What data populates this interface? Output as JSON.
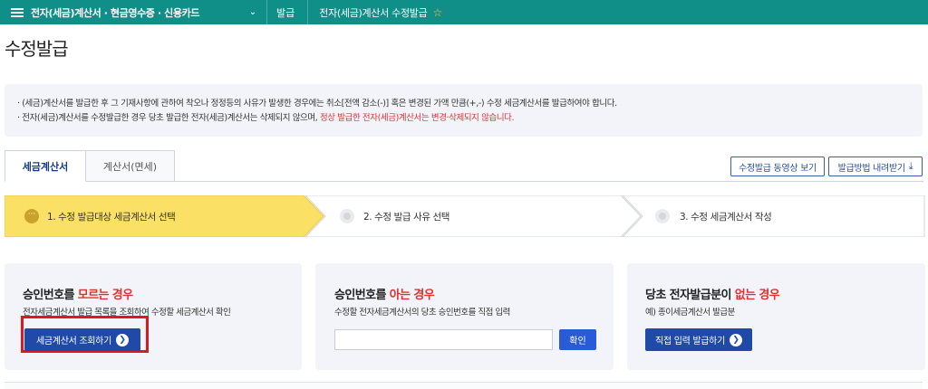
{
  "topbar": {
    "section": "전자(세금)계산서 · 현금영수증 · 신용카드",
    "crumb_issue": "발급",
    "crumb_page": "전자(세금)계산서 수정발급",
    "star": "☆"
  },
  "page_title": "수정발급",
  "notice": {
    "line1": "(세금)계산서를 발급한 후 그 기재사항에 관하여 착오나 정정등의 사유가 발생한 경우에는 취소[전액 감소(-)] 혹은 변경된 가액 만큼(+,-) 수정 세금계산서를 발급하여야 합니다.",
    "line2_main": "전자(세금)계산서를 수정발급한 경우 당초 발급한 전자(세금)계산서는 삭제되지 않으며,",
    "line2_red": "정상 발급한 전자(세금)계산서는 변경·삭제되지 않습니다."
  },
  "tabs": [
    {
      "label": "세금계산서",
      "active": true
    },
    {
      "label": "계산서(면세)",
      "active": false
    }
  ],
  "buttons": {
    "video": "수정발급 동영상 보기",
    "download": "발급방법 내려받기"
  },
  "steps": [
    {
      "label": "1. 수정 발급대상 세금계산서 선택",
      "active": true
    },
    {
      "label": "2. 수정 발급 사유 선택",
      "active": false
    },
    {
      "label": "3. 수정 세금계산서 작성",
      "active": false
    }
  ],
  "cards": {
    "unknown": {
      "title_main": "승인번호를",
      "title_red": "모르는 경우",
      "desc": "전자세금계산서 발급 목록을 조회하여 수정할 세금계산서 확인",
      "button": "세금계산서 조회하기"
    },
    "known": {
      "title_main": "승인번호를",
      "title_red": "아는 경우",
      "desc": "수정할 전자세금계산서의 당초 승인번호를 직접 입력",
      "input_value": "",
      "button": "확인"
    },
    "none": {
      "title_main": "당초 전자발급분이",
      "title_red": "없는 경우",
      "desc": "예) 종이세금계산서 발급분",
      "button": "직접 입력 발급하기"
    }
  },
  "colors": {
    "topbar": "#0f8f87",
    "active_step": "#fbe066",
    "red_text": "#e03131",
    "navy_button": "#1f4aa8",
    "highlight_box": "#e1171e"
  }
}
